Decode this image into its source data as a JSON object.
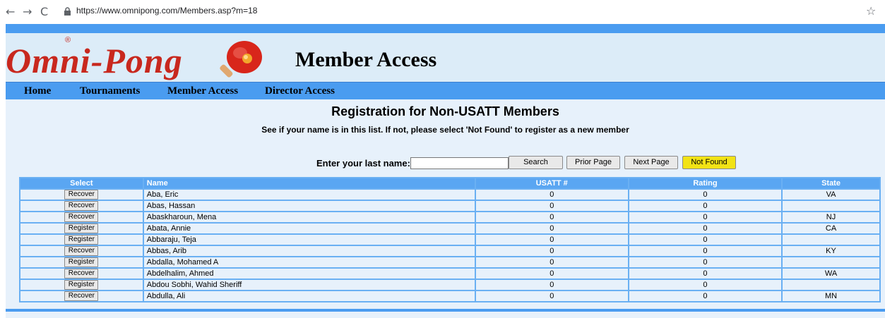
{
  "browser": {
    "url": "https://www.omnipong.com/Members.asp?m=18"
  },
  "site": {
    "logo_text": "Omni-Pong",
    "registered_mark": "®",
    "heading": "Member Access",
    "nav": [
      "Home",
      "Tournaments",
      "Member Access",
      "Director Access"
    ],
    "accent_color": "#4a9cf0",
    "logo_color": "#c8281e"
  },
  "main": {
    "title": "Registration for Non-USATT Members",
    "subtitle": "See if your name is in this list. If not, please select 'Not Found' to register as a new member",
    "search_label": "Enter your last name:",
    "search_value": "",
    "buttons": {
      "search": "Search",
      "prior": "Prior Page",
      "next": "Next Page",
      "not_found": "Not Found"
    }
  },
  "table": {
    "headers": {
      "select": "Select",
      "name": "Name",
      "usatt": "USATT #",
      "rating": "Rating",
      "state": "State"
    },
    "rows": [
      {
        "action": "Recover",
        "name": "Aba, Eric",
        "usatt": "0",
        "rating": "0",
        "state": "VA"
      },
      {
        "action": "Recover",
        "name": "Abas, Hassan",
        "usatt": "0",
        "rating": "0",
        "state": ""
      },
      {
        "action": "Recover",
        "name": "Abaskharoun, Mena",
        "usatt": "0",
        "rating": "0",
        "state": "NJ"
      },
      {
        "action": "Register",
        "name": "Abata, Annie",
        "usatt": "0",
        "rating": "0",
        "state": "CA"
      },
      {
        "action": "Register",
        "name": "Abbaraju, Teja",
        "usatt": "0",
        "rating": "0",
        "state": ""
      },
      {
        "action": "Recover",
        "name": "Abbas, Arib",
        "usatt": "0",
        "rating": "0",
        "state": "KY"
      },
      {
        "action": "Register",
        "name": "Abdalla, Mohamed A",
        "usatt": "0",
        "rating": "0",
        "state": ""
      },
      {
        "action": "Recover",
        "name": "Abdelhalim, Ahmed",
        "usatt": "0",
        "rating": "0",
        "state": "WA"
      },
      {
        "action": "Register",
        "name": "Abdou Sobhi, Wahid Sheriff",
        "usatt": "0",
        "rating": "0",
        "state": ""
      },
      {
        "action": "Recover",
        "name": "Abdulla, Ali",
        "usatt": "0",
        "rating": "0",
        "state": "MN"
      }
    ]
  }
}
